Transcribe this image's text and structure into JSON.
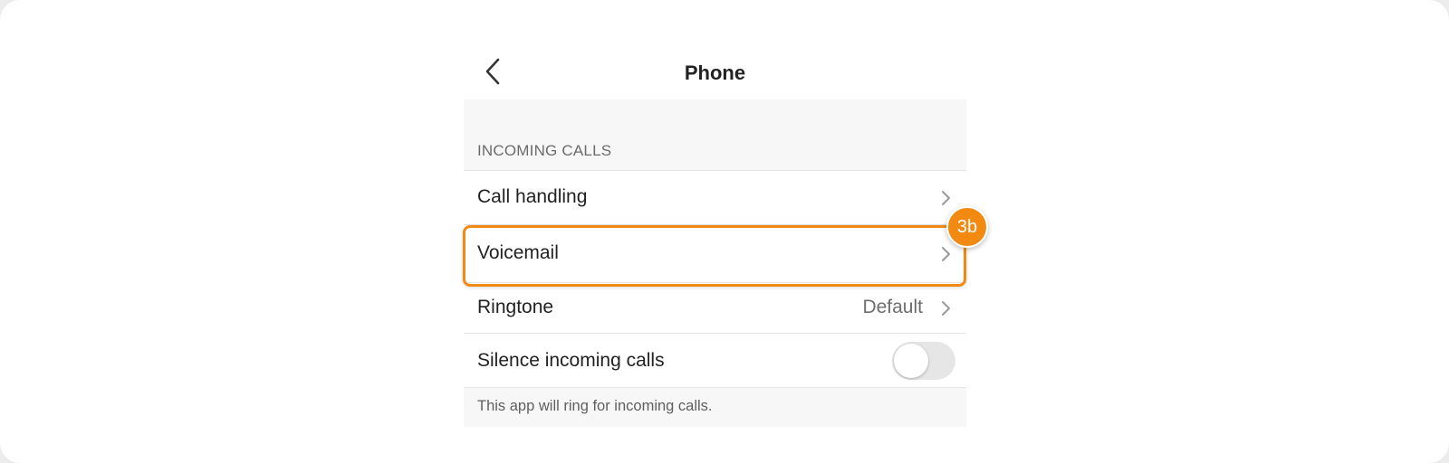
{
  "header": {
    "title": "Phone",
    "back_icon": "chevron-left-icon"
  },
  "section": {
    "header": "INCOMING CALLS"
  },
  "rows": [
    {
      "label": "Call handling",
      "icon": "chevron-right-icon"
    },
    {
      "label": "Voicemail",
      "icon": "chevron-right-icon"
    },
    {
      "label": "Ringtone",
      "value": "Default",
      "icon": "chevron-right-icon"
    },
    {
      "label": "Silence incoming calls",
      "toggle_on": false
    }
  ],
  "footer": {
    "note": "This app will ring for incoming calls."
  },
  "annotation": {
    "badge": "3b",
    "color": "#f28a11"
  }
}
